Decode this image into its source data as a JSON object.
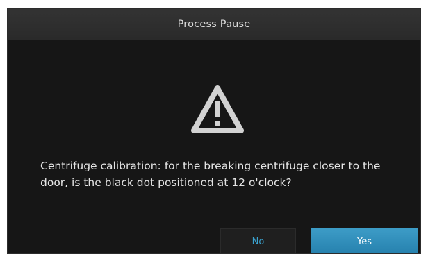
{
  "dialog": {
    "title": "Process Pause",
    "icon": "warning-icon",
    "message": "Centrifuge calibration: for the breaking centrifuge closer to the door, is the black dot positioned at 12 o'clock?",
    "buttons": {
      "no_label": "No",
      "yes_label": "Yes"
    }
  },
  "colors": {
    "background": "#161616",
    "title_bar": "#2e2e2e",
    "accent": "#2b8cb8",
    "no_text": "#3aa2cf",
    "icon": "#d2d2d2"
  }
}
